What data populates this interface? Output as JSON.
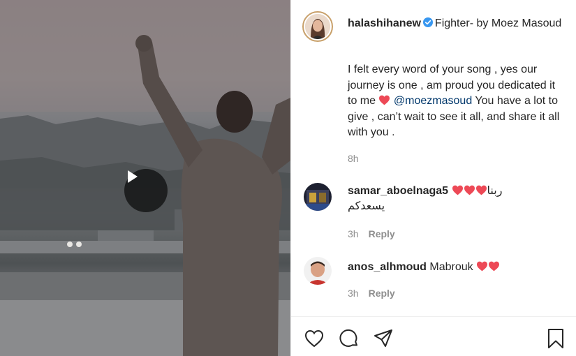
{
  "video": {
    "play_icon": "play-icon"
  },
  "post": {
    "username": "halashihanew",
    "title": "Fighter- by Moez Masoud",
    "body_line1": "I felt every word of your song , yes our journey is one , am proud you dedicated it to me",
    "mention": "@moezmasoud",
    "body_line2": "You have a lot to give , can’t wait to see it all, and share it all with you .",
    "time": "8h"
  },
  "comments": [
    {
      "username": "samar_aboelnaga5",
      "text_rtl": "ربنا",
      "text_line2": "يسعدكم",
      "time": "3h",
      "reply_label": "Reply",
      "hearts": 3
    },
    {
      "username": "anos_alhmoud",
      "text": "Mabrouk",
      "time": "3h",
      "reply_label": "Reply",
      "hearts": 2
    }
  ],
  "actions": [
    "like-icon",
    "comment-icon",
    "share-icon",
    "save-icon"
  ],
  "colors": {
    "verified": "#3897f0",
    "heart": "#ed4956",
    "mention": "#00376b",
    "muted": "#8e8e8e"
  }
}
